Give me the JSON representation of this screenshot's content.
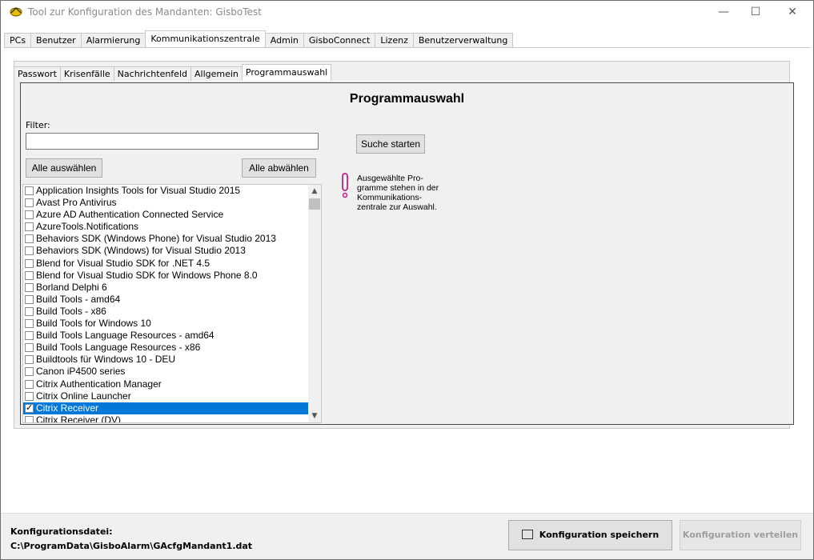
{
  "window": {
    "title": "Tool zur Konfiguration des Mandanten: GisboTest",
    "controls": {
      "minimize": "—",
      "maximize": "☐",
      "close": "✕"
    }
  },
  "main_tabs": [
    {
      "label": "PCs"
    },
    {
      "label": "Benutzer"
    },
    {
      "label": "Alarmierung"
    },
    {
      "label": "Kommunikationszentrale",
      "active": true
    },
    {
      "label": "Admin"
    },
    {
      "label": "GisboConnect"
    },
    {
      "label": "Lizenz"
    },
    {
      "label": "Benutzerverwaltung"
    }
  ],
  "sub_tabs": [
    {
      "label": "Passwort"
    },
    {
      "label": "Krisenfälle"
    },
    {
      "label": "Nachrichtenfeld"
    },
    {
      "label": "Allgemein"
    },
    {
      "label": "Programmauswahl",
      "active": true
    }
  ],
  "section": {
    "title": "Programmauswahl",
    "filter_label": "Filter:",
    "filter_value": "",
    "select_all": "Alle auswählen",
    "deselect_all": "Alle abwählen",
    "search_button": "Suche starten",
    "hint": "Ausgewählte Pro-\ngramme stehen in der\nKommunikations-\nzentrale zur Auswahl.",
    "programs": [
      {
        "label": "Application Insights Tools for Visual Studio 2015",
        "checked": false
      },
      {
        "label": "Avast Pro Antivirus",
        "checked": false
      },
      {
        "label": "Azure AD Authentication Connected Service",
        "checked": false
      },
      {
        "label": "AzureTools.Notifications",
        "checked": false
      },
      {
        "label": "Behaviors SDK (Windows Phone) for Visual Studio 2013",
        "checked": false
      },
      {
        "label": "Behaviors SDK (Windows) for Visual Studio 2013",
        "checked": false
      },
      {
        "label": "Blend for Visual Studio SDK for .NET 4.5",
        "checked": false
      },
      {
        "label": "Blend for Visual Studio SDK for Windows Phone 8.0",
        "checked": false
      },
      {
        "label": "Borland Delphi 6",
        "checked": false
      },
      {
        "label": "Build Tools - amd64",
        "checked": false
      },
      {
        "label": "Build Tools - x86",
        "checked": false
      },
      {
        "label": "Build Tools for Windows 10",
        "checked": false
      },
      {
        "label": "Build Tools Language Resources - amd64",
        "checked": false
      },
      {
        "label": "Build Tools Language Resources - x86",
        "checked": false
      },
      {
        "label": "Buildtools für Windows 10 - DEU",
        "checked": false
      },
      {
        "label": "Canon iP4500 series",
        "checked": false
      },
      {
        "label": "Citrix Authentication Manager",
        "checked": false
      },
      {
        "label": "Citrix Online Launcher",
        "checked": false
      },
      {
        "label": "Citrix Receiver",
        "checked": true,
        "selected": true
      },
      {
        "label": "Citrix Receiver (DV)",
        "checked": false
      }
    ]
  },
  "footer": {
    "config_label": "Konfigurationsdatei:",
    "config_path": "C:\\ProgramData\\GisboAlarm\\GAcfgMandant1.dat",
    "save_button": "Konfiguration speichern",
    "distribute_button": "Konfiguration verteilen"
  },
  "colors": {
    "selection": "#0078d7",
    "panel_bg": "#f0f0f0",
    "exclamation": "#d01a8c"
  }
}
